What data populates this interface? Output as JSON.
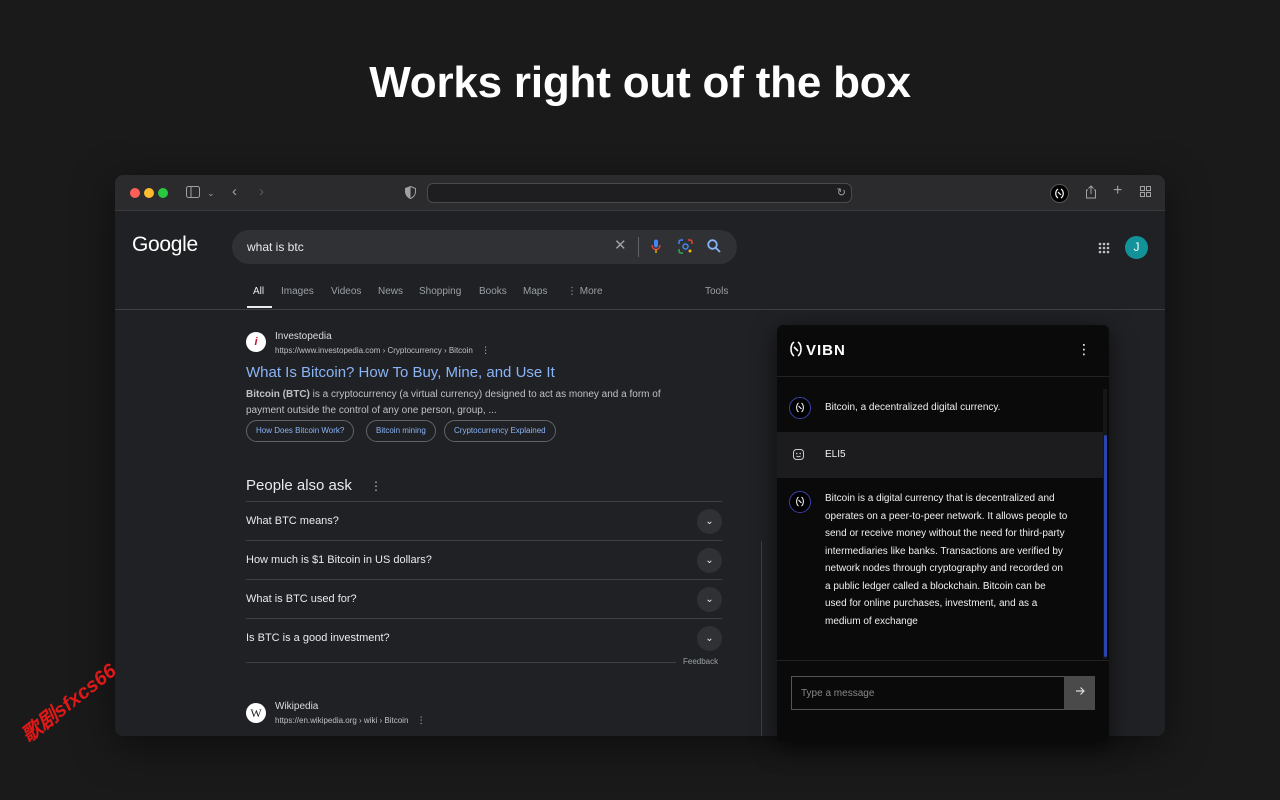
{
  "headline": "Works right out of the box",
  "browser": {
    "traffic_lights": [
      "#ff5f57",
      "#febc2e",
      "#28c840"
    ],
    "address_value": "",
    "extension_icon": "vibn-extension-icon"
  },
  "google": {
    "logo": "Google",
    "query": "what is btc",
    "avatar_letter": "J",
    "tabs": [
      "All",
      "Images",
      "Videos",
      "News",
      "Shopping",
      "Books",
      "Maps",
      "⋮ More"
    ],
    "tools": "Tools",
    "result1": {
      "favicon": "i",
      "site": "Investopedia",
      "url": "https://www.investopedia.com › Cryptocurrency › Bitcoin",
      "title": "What Is Bitcoin? How To Buy, Mine, and Use It",
      "snippet_bold": "Bitcoin (BTC)",
      "snippet_rest": " is a cryptocurrency (a virtual currency) designed to act as money and a form of payment outside the control of any one person, group, ...",
      "chips": [
        "How Does Bitcoin Work?",
        "Bitcoin mining",
        "Cryptocurrency Explained"
      ]
    },
    "paa": {
      "title": "People also ask",
      "questions": [
        "What BTC means?",
        "How much is $1 Bitcoin in US dollars?",
        "What is BTC used for?",
        "Is BTC is a good investment?"
      ],
      "feedback": "Feedback"
    },
    "result2": {
      "favicon": "W",
      "site": "Wikipedia",
      "url": "https://en.wikipedia.org › wiki › Bitcoin"
    }
  },
  "vibn": {
    "logo": "VIBN",
    "messages": [
      {
        "role": "bot",
        "text": "Bitcoin, a decentralized digital currency."
      },
      {
        "role": "user",
        "text": "ELI5"
      },
      {
        "role": "bot",
        "text": "Bitcoin is a digital currency that is decentralized and operates on a peer-to-peer network. It allows people to send or receive money without the need for third-party intermediaries like banks. Transactions are verified by network nodes through cryptography and recorded on a public ledger called a blockchain. Bitcoin can be used for online purchases, investment, and as a medium of exchange"
      }
    ],
    "input_placeholder": "Type a message",
    "scroll_color": "#2a45b0"
  },
  "watermark": "歌剧sfxcs66"
}
